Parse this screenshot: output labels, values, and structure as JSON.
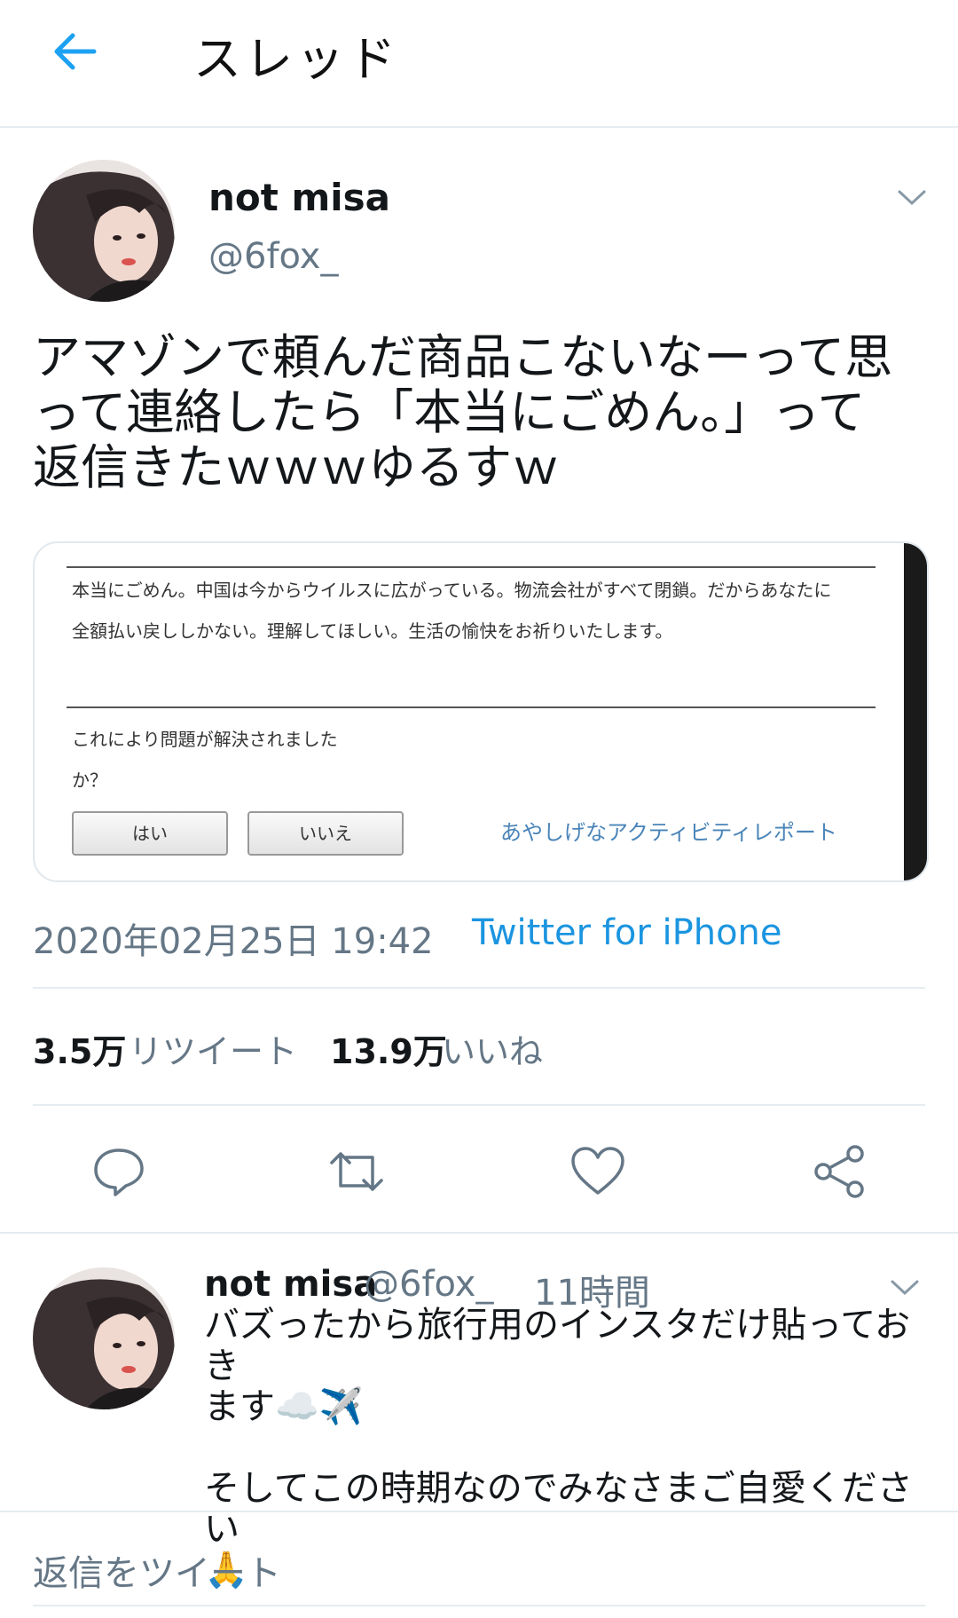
{
  "header": {
    "title": "スレッド"
  },
  "tweet": {
    "display_name": "not misa",
    "handle": "@6fox_",
    "text_lines": [
      "アマゾンで頼んだ商品こないなーって思",
      "って連絡したら「本当にごめん。」って",
      "返信きたｗｗｗゆるすｗ"
    ],
    "image": {
      "message_line1": "本当にごめん。中国は今からウイルスに広がっている。物流会社がすべて閉鎖。だからあなたに",
      "message_line2": "全額払い戻ししかない。理解してほしい。生活の愉快をお祈りいたします。",
      "question_line1": "これにより問題が解決されました",
      "question_line2": "か？",
      "yes_button": "はい",
      "no_button": "いいえ",
      "report_link": "あやしげなアクティビティレポート"
    },
    "timestamp": "2020年02月25日 19:42",
    "source": "Twitter for iPhone",
    "retweets_count": "3.5万",
    "retweets_label": "リツイート",
    "likes_count": "13.9万",
    "likes_label": "いいね"
  },
  "reply": {
    "display_name": "not misa",
    "handle": "@6fox_",
    "time": "11時間",
    "text": "バズったから旅行用のインスタだけ貼っておき\nます☁️✈️\n\nそしてこの時期なのでみなさまご自愛ください\n🙏"
  },
  "reply_bar": {
    "placeholder": "返信をツイート"
  },
  "colors": {
    "accent": "#1b95e0",
    "secondary_text": "#657786",
    "divider": "#e6ecf0"
  }
}
